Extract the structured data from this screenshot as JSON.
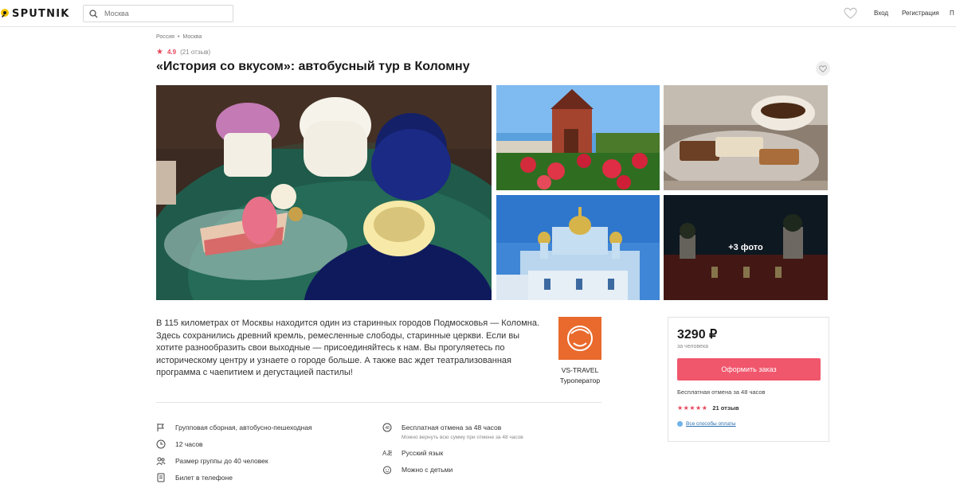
{
  "header": {
    "logo_text": "SPUTNIK",
    "search_placeholder": "Москва",
    "login_label": "Вход",
    "register_label": "Регистрация",
    "cut_label": "П"
  },
  "breadcrumb": [
    "Россия",
    "Москва"
  ],
  "rating": {
    "value": "4.9",
    "count_label": "(21 отзыв)"
  },
  "tour": {
    "title": "«История со вкусом»: автобусный тур в Коломну",
    "description": "В 115 километрах от Москвы находится один из старинных городов Подмосковья — Коломна. Здесь сохранились древний кремль, ремесленные слободы, старинные церкви. Если вы хотите разнообразить свои выходные — присоединяйтесь к нам. Вы прогуляетесь по историческому центру и узнаете о городе больше. А также вас ждет театрализованная программа с чаепитием и дегустацией пастилы!"
  },
  "gallery": {
    "more_label": "+3 фото"
  },
  "operator": {
    "name": "VS-TRAVEL",
    "role": "Туроператор"
  },
  "features_left": [
    {
      "icon": "flag-icon",
      "label": "Групповая сборная, автобусно-пешеходная"
    },
    {
      "icon": "clock-icon",
      "label": "12 часов"
    },
    {
      "icon": "group-icon",
      "label": "Размер группы до 40 человек"
    },
    {
      "icon": "ticket-icon",
      "label": "Билет в телефоне"
    }
  ],
  "features_right": [
    {
      "icon": "refund-48-icon",
      "label": "Бесплатная отмена за 48 часов",
      "sub": "Можно вернуть всю сумму при отмене за 48 часов"
    },
    {
      "icon": "language-icon",
      "label": "Русский язык"
    },
    {
      "icon": "child-icon",
      "label": "Можно с детьми"
    }
  ],
  "booking": {
    "price": "3290 ₽",
    "per_person": "за человека",
    "order_label": "Оформить заказ",
    "cancel_note": "Бесплатная отмена за 48 часов",
    "stars": "★★★★★",
    "reviews_label": "21 отзыв",
    "payment_link": "Все способы оплаты"
  },
  "colors": {
    "accent": "#f0566c",
    "star": "#e8465b",
    "operator_bg": "#e96a2c",
    "link": "#2a6fb0"
  }
}
